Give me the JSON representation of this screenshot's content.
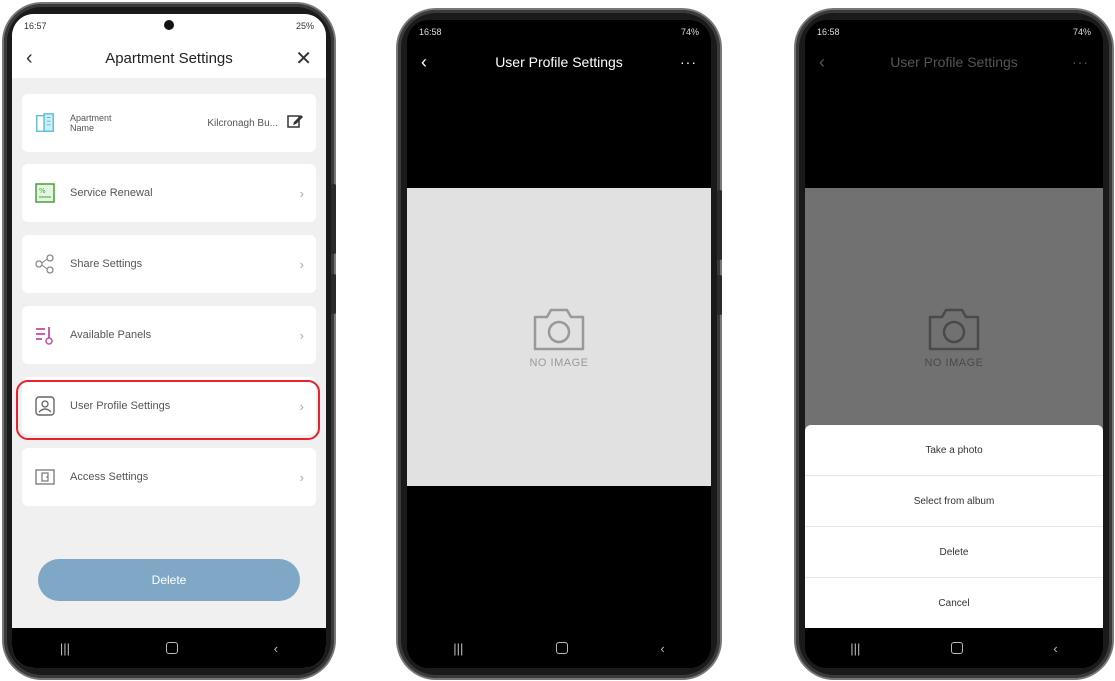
{
  "phone1": {
    "status": {
      "time": "16:57",
      "right": "25%"
    },
    "header": {
      "title": "Apartment Settings",
      "back": "‹",
      "close": "✕"
    },
    "rows": [
      {
        "label": "Apartment Name",
        "value": "Kilcronagh Bu...",
        "icon": "building-icon"
      },
      {
        "label": "Service Renewal",
        "chevron": "›",
        "icon": "renewal-icon"
      },
      {
        "label": "Share Settings",
        "chevron": "›",
        "icon": "share-icon"
      },
      {
        "label": "Available Panels",
        "chevron": "›",
        "icon": "panels-icon"
      },
      {
        "label": "User Profile Settings",
        "chevron": "›",
        "icon": "user-profile-icon"
      },
      {
        "label": "Access Settings",
        "chevron": "›",
        "icon": "access-icon"
      }
    ],
    "delete_label": "Delete",
    "highlight_color": "#e8222b",
    "accent": "#7fa8c7"
  },
  "phone2": {
    "status": {
      "time": "16:58",
      "right": "74%"
    },
    "header": {
      "title": "User Profile Settings",
      "back": "‹",
      "more": "···"
    },
    "no_image": "NO IMAGE"
  },
  "phone3": {
    "status": {
      "time": "16:58",
      "right": "74%"
    },
    "header": {
      "title": "User Profile Settings",
      "back": "‹",
      "more": "···"
    },
    "no_image": "NO IMAGE",
    "sheet": [
      "Take a photo",
      "Select from album",
      "Delete",
      "Cancel"
    ]
  },
  "navbar": {
    "recent": "|||",
    "back": "‹"
  }
}
